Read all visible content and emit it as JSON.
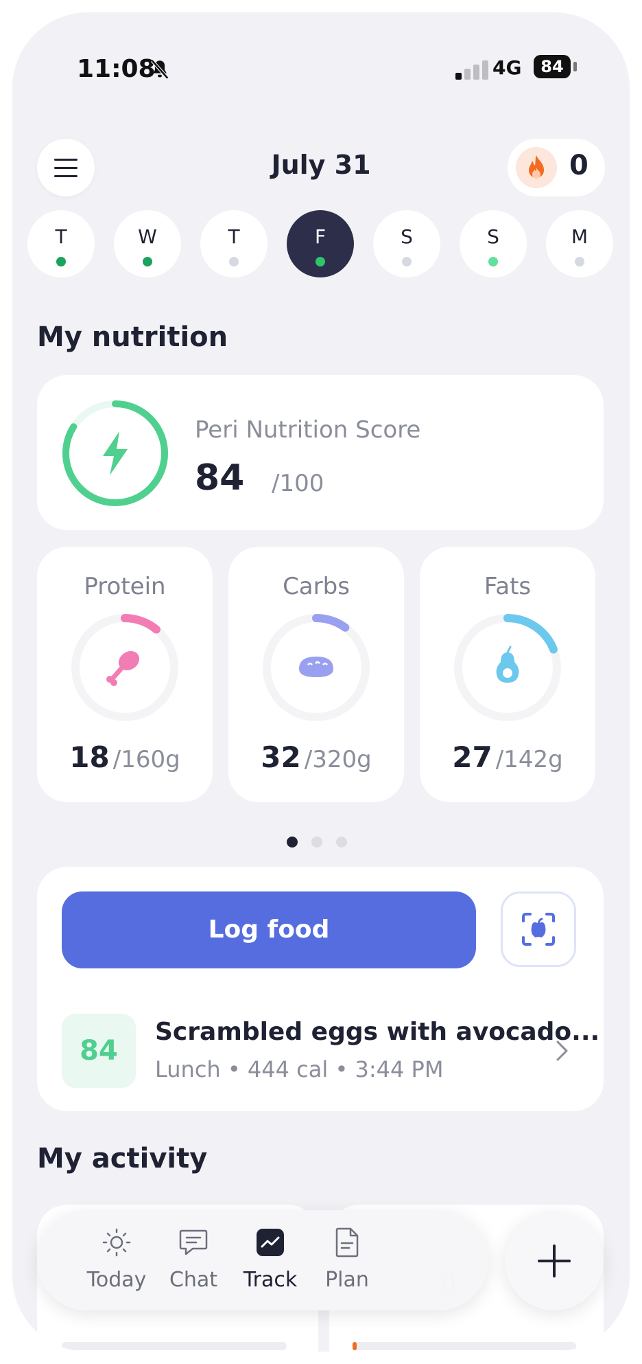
{
  "status_bar": {
    "time": "11:08",
    "network": "4G",
    "battery": "84"
  },
  "header": {
    "date": "July 31",
    "streak_count": "0"
  },
  "week_days": [
    {
      "letter": "T",
      "dot_color": "#1aa35a"
    },
    {
      "letter": "W",
      "dot_color": "#1aa35a"
    },
    {
      "letter": "T",
      "dot_color": "#d6d9e2"
    },
    {
      "letter": "F",
      "dot_color": "#2fc46b"
    },
    {
      "letter": "S",
      "dot_color": "#d6d9e2"
    },
    {
      "letter": "S",
      "dot_color": "#62e09a"
    },
    {
      "letter": "M",
      "dot_color": "#d6d9e2"
    }
  ],
  "nutrition": {
    "section_title": "My nutrition",
    "score_label": "Peri Nutrition Score",
    "score_value": "84",
    "score_max": "/100",
    "score_fraction": 0.84,
    "macros": [
      {
        "name": "Protein",
        "value": "18",
        "target": "/160g",
        "fraction": 0.11,
        "color": "#f27db4",
        "icon": "drumstick-icon"
      },
      {
        "name": "Carbs",
        "value": "32",
        "target": "/320g",
        "fraction": 0.1,
        "color": "#9aa0f0",
        "icon": "bread-icon"
      },
      {
        "name": "Fats",
        "value": "27",
        "target": "/142g",
        "fraction": 0.19,
        "color": "#6cc8ec",
        "icon": "avocado-icon"
      }
    ]
  },
  "log": {
    "button_label": "Log food",
    "meal": {
      "score": "84",
      "name": "Scrambled eggs with avocado...",
      "details": "Lunch • 444 cal • 3:44 PM"
    }
  },
  "activity": {
    "section_title": "My activity",
    "partial_value": "0"
  },
  "tabs": [
    {
      "label": "Today",
      "icon": "sun-icon"
    },
    {
      "label": "Chat",
      "icon": "chat-icon"
    },
    {
      "label": "Track",
      "icon": "trend-icon"
    },
    {
      "label": "Plan",
      "icon": "document-icon"
    }
  ],
  "colors": {
    "accent": "#566de0",
    "score_green": "#4fd08e",
    "dark": "#1f2233"
  }
}
